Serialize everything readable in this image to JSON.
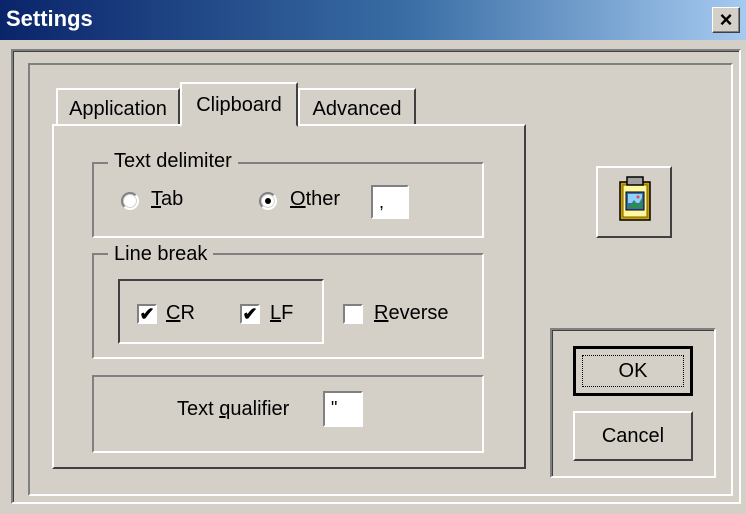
{
  "window": {
    "title": "Settings",
    "close_label": "×"
  },
  "tabs": [
    {
      "label": "Application",
      "active": false
    },
    {
      "label": "Clipboard",
      "active": true
    },
    {
      "label": "Advanced",
      "active": false
    }
  ],
  "text_delimiter": {
    "group_label": "Text delimiter",
    "tab_option": {
      "accel": "T",
      "rest": "ab",
      "selected": false
    },
    "other_option": {
      "accel": "O",
      "rest": "ther",
      "selected": true
    },
    "other_value": ","
  },
  "line_break": {
    "group_label": "Line break",
    "cr": {
      "accel": "C",
      "rest": "R",
      "checked": true
    },
    "lf": {
      "accel": "L",
      "rest": "F",
      "checked": true
    },
    "reverse": {
      "accel": "R",
      "rest": "everse",
      "checked": false
    }
  },
  "text_qualifier": {
    "label_pre": "Text ",
    "accel": "q",
    "label_post": "ualifier",
    "value": "\""
  },
  "buttons": {
    "ok_label": "OK",
    "cancel_label": "Cancel"
  },
  "icons": {
    "clipboard_button": "clipboard-image-icon",
    "checkmark": "✔"
  }
}
